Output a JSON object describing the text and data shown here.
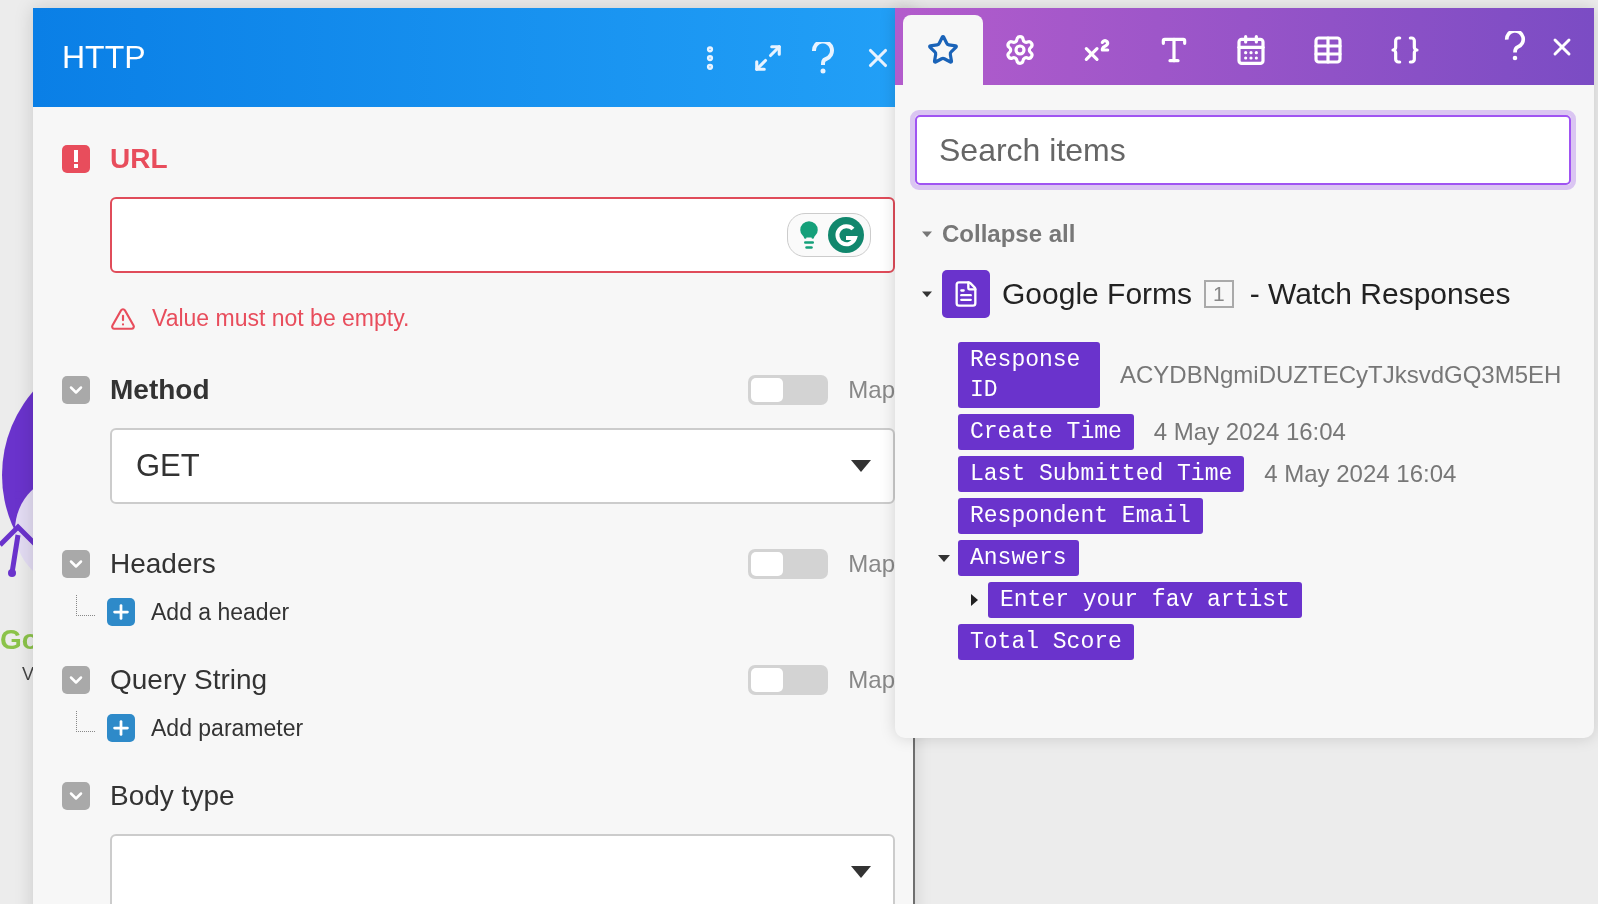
{
  "canvas_node": {
    "label": "Go",
    "sublabel": "V"
  },
  "module_panel": {
    "title": "HTTP",
    "fields": [
      {
        "kind": "url",
        "label": "URL",
        "error": "Value must not be empty."
      },
      {
        "kind": "select",
        "label": "Method",
        "required": true,
        "map_label": "Map",
        "map_on": false,
        "value": "GET"
      },
      {
        "kind": "list",
        "label": "Headers",
        "required": false,
        "map_label": "Map",
        "map_on": false,
        "add_label": "Add a header"
      },
      {
        "kind": "list",
        "label": "Query String",
        "required": false,
        "map_label": "Map",
        "map_on": false,
        "add_label": "Add parameter"
      },
      {
        "kind": "select",
        "label": "Body type",
        "required": false
      }
    ]
  },
  "mapping_panel": {
    "tabs": [
      {
        "kind": "star",
        "selected": true
      },
      {
        "kind": "settings",
        "selected": false
      },
      {
        "kind": "math",
        "selected": false
      },
      {
        "kind": "text",
        "selected": false
      },
      {
        "kind": "date",
        "selected": false
      },
      {
        "kind": "array",
        "selected": false
      },
      {
        "kind": "json",
        "selected": false
      }
    ],
    "search": {
      "placeholder": "Search items"
    },
    "collapse_all": "Collapse all",
    "module": {
      "name": "Google Forms",
      "index": "1",
      "title": "- Watch Responses",
      "expanded": true,
      "items": [
        {
          "label": "Response ID",
          "value": "ACYDBNgmiDUZTECyTJksvdGQ3M5EH"
        },
        {
          "label": "Create Time",
          "value": "4 May 2024 16:04"
        },
        {
          "label": "Last Submitted Time",
          "value": "4 May 2024 16:04"
        },
        {
          "label": "Respondent Email"
        },
        {
          "label": "Answers",
          "expanded": true,
          "children": [
            {
              "label": "Enter your fav artist",
              "expanded": false
            }
          ]
        },
        {
          "label": "Total Score"
        }
      ]
    }
  }
}
